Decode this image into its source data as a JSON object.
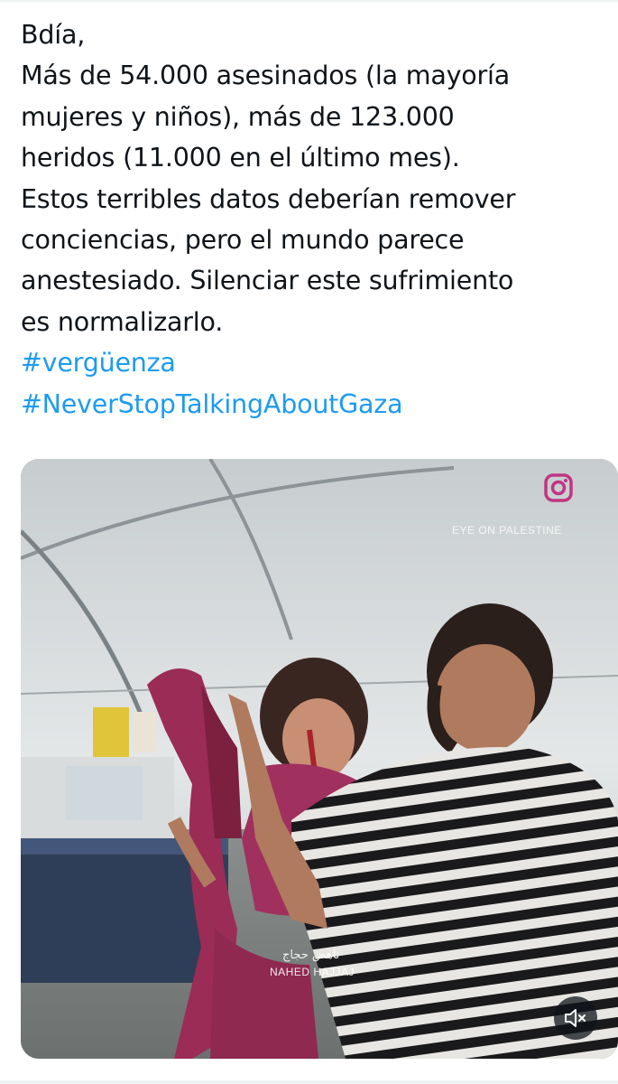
{
  "tweet": {
    "lines": [
      "Bdía,",
      "Más de 54.000 asesinados (la mayoría",
      "mujeres y niños), más de 123.000",
      "heridos (11.000 en el último mes).",
      "Estos terribles datos deberían remover",
      "conciencias, pero el mundo parece",
      "anestesiado. Silenciar este sufrimiento",
      "es normalizarlo."
    ],
    "hashtags": [
      "#vergüenza",
      "#NeverStopTalkingAboutGaza"
    ]
  },
  "media": {
    "type": "video",
    "overlay_top": "EYE ON PALESTINE",
    "overlay_arabic": "ناهض حجاج",
    "overlay_name": "NAHED HAJJAJ",
    "icons": {
      "brand": "instagram-icon",
      "mute": "volume-muted-icon"
    }
  },
  "colors": {
    "text": "#0f1419",
    "hashtag": "#1d9bf0",
    "divider": "#eff3f4",
    "instagram": "#c13584"
  }
}
